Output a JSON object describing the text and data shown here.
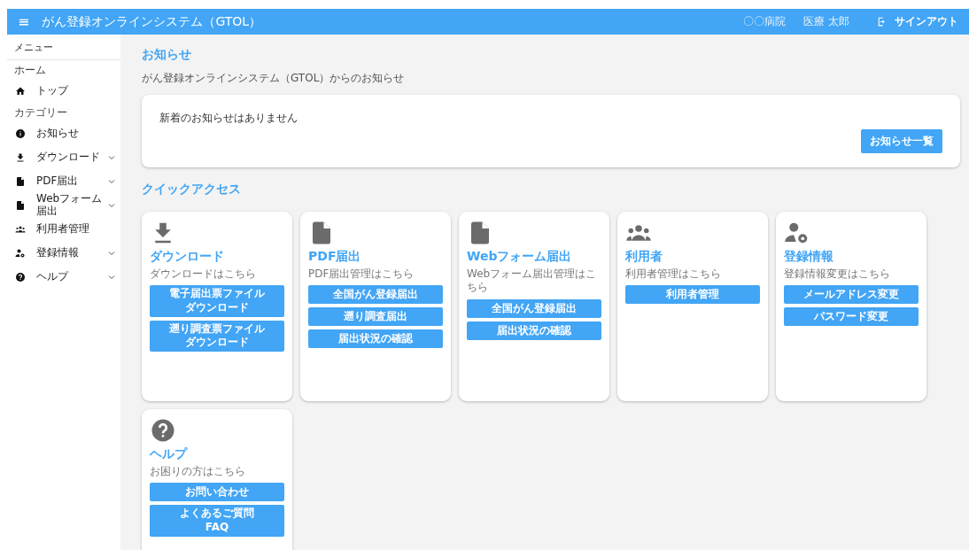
{
  "header": {
    "menu_icon": "≡",
    "title": "がん登録オンラインシステム（GTOL）",
    "hospital": "〇〇病院",
    "user": "医療 太郎",
    "signout": "サインアウト"
  },
  "sidebar": {
    "title": "メニュー",
    "sections": [
      {
        "label": "ホーム",
        "items": [
          {
            "kind": "home",
            "label": "トップ",
            "expandable": false
          }
        ]
      },
      {
        "label": "カテゴリー",
        "items": [
          {
            "kind": "info",
            "label": "お知らせ",
            "expandable": false
          },
          {
            "kind": "download",
            "label": "ダウンロード",
            "expandable": true
          },
          {
            "kind": "file",
            "label": "PDF届出",
            "expandable": true
          },
          {
            "kind": "file",
            "label": "Webフォーム届出",
            "expandable": true
          },
          {
            "kind": "people",
            "label": "利用者管理",
            "expandable": false
          },
          {
            "kind": "settings",
            "label": "登録情報",
            "expandable": true
          },
          {
            "kind": "help",
            "label": "ヘルプ",
            "expandable": true
          }
        ]
      }
    ]
  },
  "notice": {
    "title": "お知らせ",
    "subtitle": "がん登録オンラインシステム（GTOL）からのお知らせ",
    "message": "新着のお知らせはありません",
    "button": "お知らせ一覧"
  },
  "quick_access": {
    "title": "クイックアクセス",
    "cards": [
      {
        "kind": "download",
        "title": "ダウンロード",
        "description": "ダウンロードはこちら",
        "buttons": [
          "電子届出票ファイルダウンロード",
          "遡り調査票ファイルダウンロード"
        ]
      },
      {
        "kind": "file",
        "title": "PDF届出",
        "description": "PDF届出管理はこちら",
        "buttons": [
          "全国がん登録届出",
          "遡り調査届出",
          "届出状況の確認"
        ]
      },
      {
        "kind": "file",
        "title": "Webフォーム届出",
        "description": "Webフォーム届出管理はこちら",
        "buttons": [
          "全国がん登録届出",
          "届出状況の確認"
        ]
      },
      {
        "kind": "people",
        "title": "利用者",
        "description": "利用者管理はこちら",
        "buttons": [
          "利用者管理"
        ]
      },
      {
        "kind": "settings",
        "title": "登録情報",
        "description": "登録情報変更はこちら",
        "buttons": [
          "メールアドレス変更",
          "パスワード変更"
        ]
      },
      {
        "kind": "help",
        "title": "ヘルプ",
        "description": "お困りの方はこちら",
        "buttons": [
          "お問い合わせ",
          "よくあるご質問FAQ"
        ]
      }
    ]
  }
}
